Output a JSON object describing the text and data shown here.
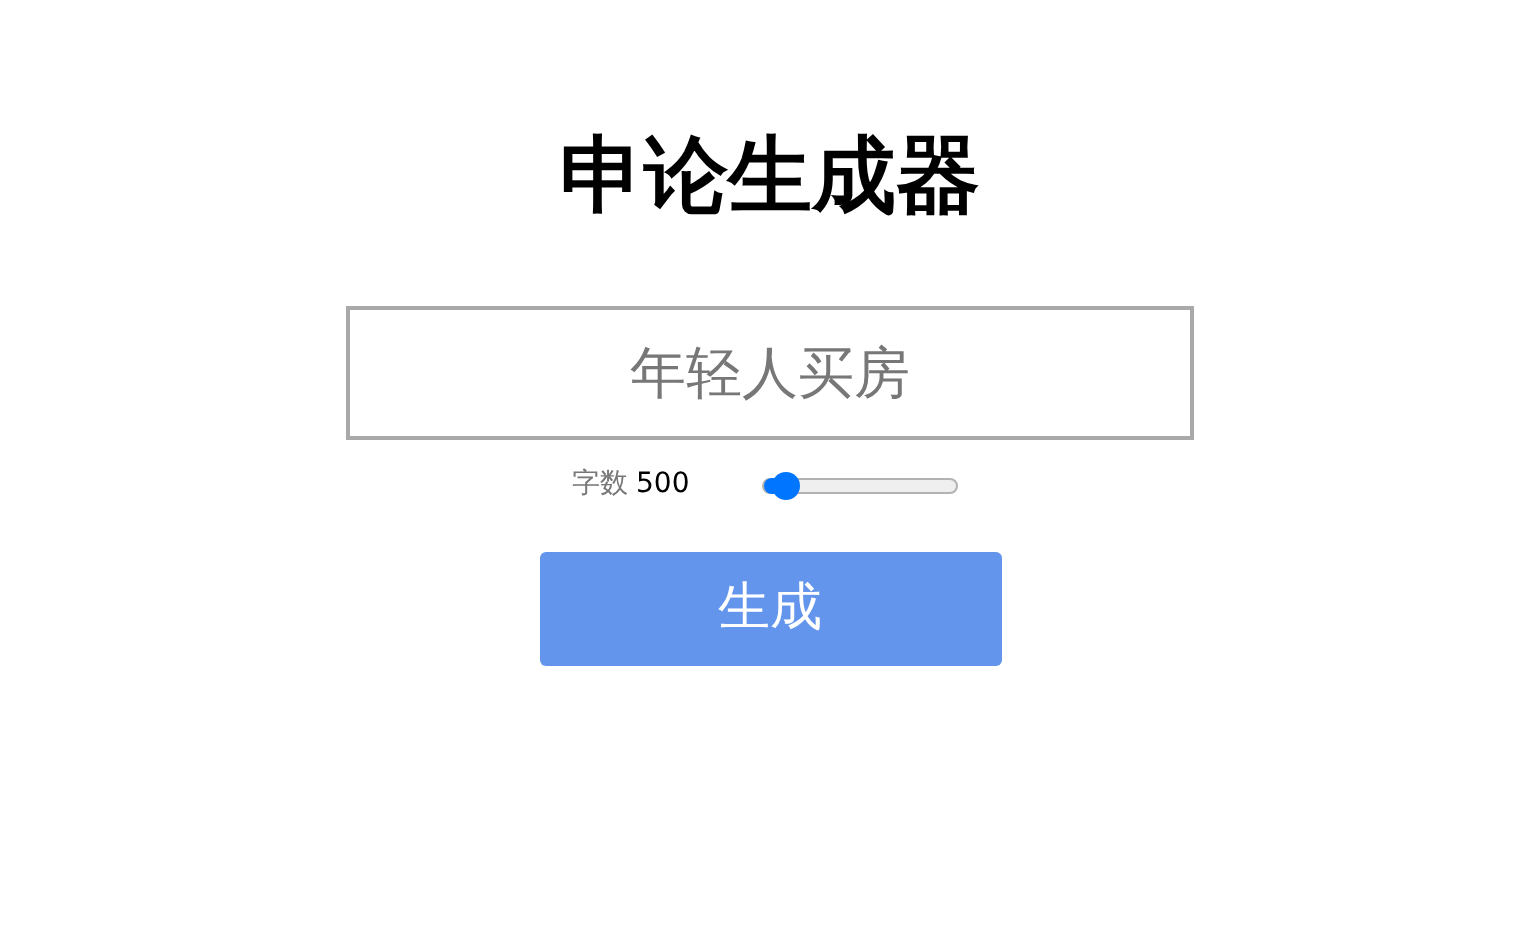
{
  "title": "申论生成器",
  "topic_field": {
    "placeholder": "年轻人买房"
  },
  "word_count": {
    "label": "字数",
    "value": "500",
    "level": 0.1
  },
  "generate_button": {
    "label": "生成"
  }
}
